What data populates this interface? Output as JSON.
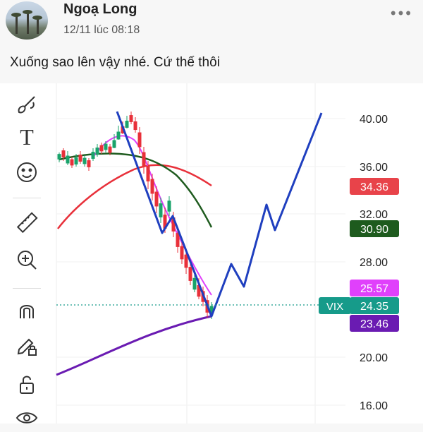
{
  "post": {
    "author": "Ngoạ Long",
    "timestamp": "12/11 lúc 08:18",
    "text": "Xuống sao lên vậy nhé. Cứ thế thôi",
    "more_icon": "more-dots-icon"
  },
  "toolbar": {
    "tools": [
      {
        "name": "brush-icon"
      },
      {
        "name": "text-tool-icon",
        "glyph": "T"
      },
      {
        "name": "emoji-icon"
      },
      {
        "name": "ruler-icon"
      },
      {
        "name": "zoom-in-icon"
      },
      {
        "name": "magnet-icon"
      },
      {
        "name": "lock-pencil-icon"
      },
      {
        "name": "unlock-icon"
      },
      {
        "name": "eye-icon"
      }
    ]
  },
  "chart_data": {
    "type": "candlestick",
    "price_axis": {
      "ticks": [
        "40.00",
        "36.00",
        "32.00",
        "28.00",
        "20.00",
        "16.00"
      ]
    },
    "price_labels": [
      {
        "value": "34.36",
        "color": "#e8434a"
      },
      {
        "value": "30.90",
        "color": "#1e5b1e"
      },
      {
        "value": "25.57",
        "color": "#e040fb"
      },
      {
        "value": "24.35",
        "color": "#169b8a",
        "prefix": "VIX"
      },
      {
        "value": "23.46",
        "color": "#6a1bb2"
      }
    ],
    "current_price": "24.35",
    "ticker": "VIX"
  }
}
